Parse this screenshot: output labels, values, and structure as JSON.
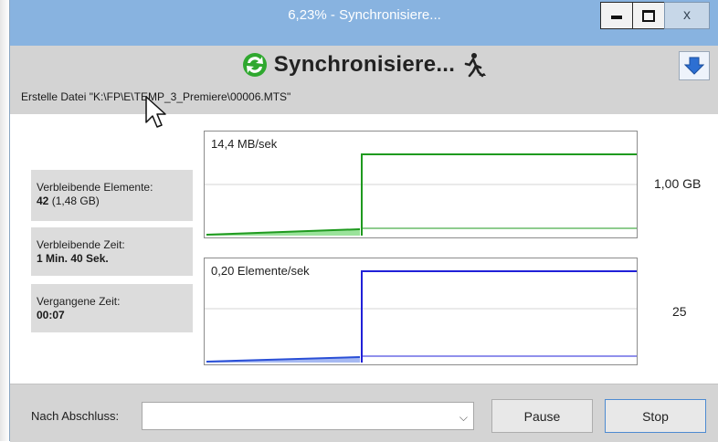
{
  "window": {
    "title": "6,23% - Synchronisiere...",
    "close_label": "x"
  },
  "header": {
    "title": "Synchronisiere...",
    "status_line": "Erstelle Datei \"K:\\FP\\E\\TEMP_3_Premiere\\00006.MTS\""
  },
  "stats": {
    "remaining_items_label": "Verbleibende Elemente:",
    "remaining_items_value": "42",
    "remaining_items_size": "(1,48 GB)",
    "remaining_time_label": "Verbleibende Zeit:",
    "remaining_time_value": "1 Min. 40 Sek.",
    "elapsed_time_label": "Vergangene Zeit:",
    "elapsed_time_value": "00:07"
  },
  "graphs": {
    "speed_label": "14,4 MB/sek",
    "speed_scale": "1,00 GB",
    "items_label": "0,20 Elemente/sek",
    "items_scale": "25"
  },
  "footer": {
    "after_label": "Nach Abschluss:",
    "after_value": "",
    "pause_label": "Pause",
    "stop_label": "Stop"
  },
  "colors": {
    "title_bar": "#88b3e0",
    "speed_line": "#1f9a1f",
    "items_line": "#2020d8"
  }
}
